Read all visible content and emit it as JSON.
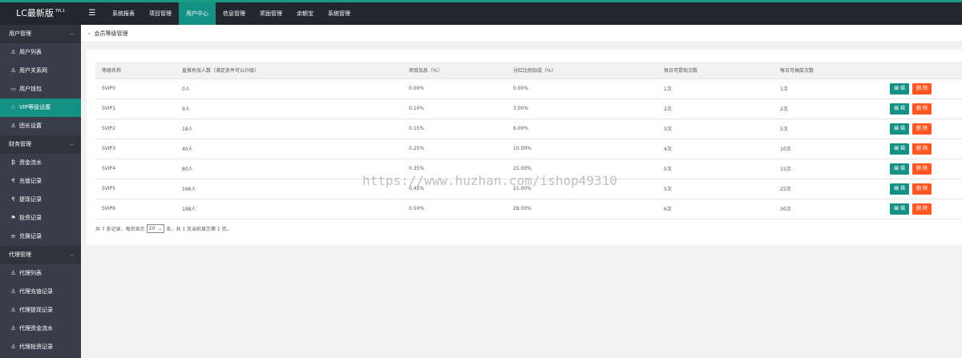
{
  "app": {
    "logo": "LC最新版",
    "logo_sup": "TPL1",
    "menu_toggle_icon": "hamburger-icon"
  },
  "topnav": [
    {
      "label": "系统报表",
      "active": false
    },
    {
      "label": "项目管理",
      "active": false
    },
    {
      "label": "用户中心",
      "active": true
    },
    {
      "label": "信息管理",
      "active": false
    },
    {
      "label": "奖励管理",
      "active": false
    },
    {
      "label": "余额宝",
      "active": false
    },
    {
      "label": "系统管理",
      "active": false
    }
  ],
  "sidebar": {
    "groups": [
      {
        "label": "用户管理",
        "items": [
          {
            "label": "用户列表",
            "icon": "user-icon",
            "glyph": "♙",
            "active": false
          },
          {
            "label": "用户关系网",
            "icon": "user-icon",
            "glyph": "♙",
            "active": false
          },
          {
            "label": "用户钱包",
            "icon": "wallet-icon",
            "glyph": "▭",
            "active": false
          },
          {
            "label": "VIP等级设置",
            "icon": "star-icon",
            "glyph": "☆",
            "active": true
          },
          {
            "label": "团长设置",
            "icon": "user-icon",
            "glyph": "♙",
            "active": false
          }
        ]
      },
      {
        "label": "财务管理",
        "items": [
          {
            "label": "资金流水",
            "icon": "bitcoin-icon",
            "glyph": "₿",
            "active": false
          },
          {
            "label": "充值记录",
            "icon": "rupee-icon",
            "glyph": "₹",
            "active": false
          },
          {
            "label": "提现记录",
            "icon": "rupee-icon",
            "glyph": "₹",
            "active": false
          },
          {
            "label": "投资记录",
            "icon": "flag-icon",
            "glyph": "⚑",
            "active": false
          },
          {
            "label": "兑换记录",
            "icon": "list-icon",
            "glyph": "≡",
            "active": false
          }
        ]
      },
      {
        "label": "代理管理",
        "items": [
          {
            "label": "代理列表",
            "icon": "user-icon",
            "glyph": "♙",
            "active": false
          },
          {
            "label": "代理充值记录",
            "icon": "user-icon",
            "glyph": "♙",
            "active": false
          },
          {
            "label": "代理提现记录",
            "icon": "user-icon",
            "glyph": "♙",
            "active": false
          },
          {
            "label": "代理资金流水",
            "icon": "user-icon",
            "glyph": "♙",
            "active": false
          },
          {
            "label": "代理投资记录",
            "icon": "user-icon",
            "glyph": "♙",
            "active": false
          }
        ]
      }
    ]
  },
  "breadcrumb": {
    "arrow": "»",
    "label": "会员等级管理"
  },
  "table": {
    "columns": [
      "等级名称",
      "直推有效人数（满足条件可以升级）",
      "项目加息（%）",
      "分红比例加成（%）",
      "每日可提现次数",
      "每日可抽奖次数",
      ""
    ],
    "rows": [
      [
        "SVIP0",
        "0人",
        "0.00%",
        "0.00%",
        "1次",
        "1次"
      ],
      [
        "SVIP1",
        "9人",
        "0.10%",
        "3.00%",
        "2次",
        "2次"
      ],
      [
        "SVIP2",
        "18人",
        "0.15%",
        "6.00%",
        "3次",
        "5次"
      ],
      [
        "SVIP3",
        "40人",
        "0.25%",
        "10.00%",
        "4次",
        "10次"
      ],
      [
        "SVIP4",
        "80人",
        "0.35%",
        "15.00%",
        "5次",
        "15次"
      ],
      [
        "SVIP5",
        "166人",
        "0.45%",
        "21.00%",
        "5次",
        "25次"
      ],
      [
        "SVIP6",
        "198人",
        "0.50%",
        "28.00%",
        "6次",
        "30次"
      ]
    ],
    "edit_label": "编 辑",
    "delete_label": "删 除"
  },
  "pager": {
    "prefix": "共 7 条记录，每页显示",
    "page_size": "20",
    "suffix": "条，共 1 页当前显示第 1 页。"
  },
  "watermark": "https://www.huzhan.com/ishop49310",
  "colors": {
    "accent": "#149085",
    "danger": "#ff5722",
    "sidebar_bg": "#393d49",
    "topbar_bg": "#23262e"
  }
}
